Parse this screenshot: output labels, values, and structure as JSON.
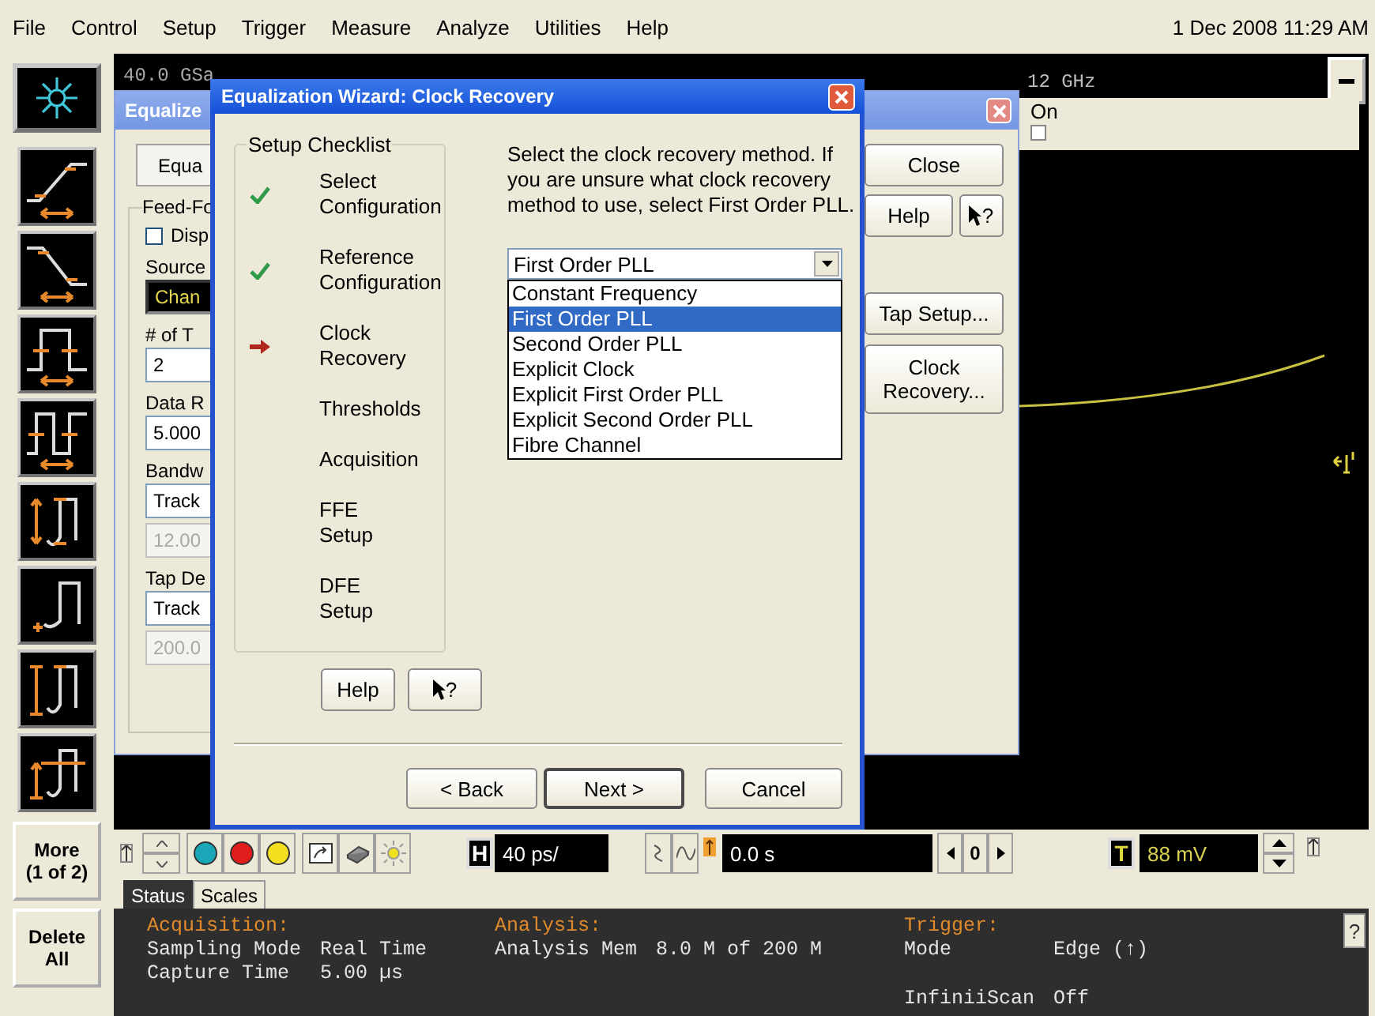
{
  "menu_bar": {
    "items": [
      "File",
      "Control",
      "Setup",
      "Trigger",
      "Measure",
      "Analyze",
      "Utilities",
      "Help"
    ],
    "datetime": "1 Dec 2008 11:29 AM"
  },
  "toolbar": {
    "buttons": [
      "More\n(1 of 2)",
      "Delete\nAll"
    ]
  },
  "scope": {
    "sample_rate": "40.0 GSa",
    "bandwidth": "12 GHz"
  },
  "equalize_window": {
    "title": "Equalize",
    "tab": "Equa",
    "group": "Feed-Fo",
    "display_checkbox": {
      "label": "Disp",
      "checked": false
    },
    "fields": [
      {
        "label": "Source",
        "value": "Chan",
        "kind": "channel"
      },
      {
        "label": "# of T",
        "value": "2",
        "kind": "input"
      },
      {
        "label": "Data R",
        "value": "5.000",
        "kind": "input"
      },
      {
        "label": "Bandw",
        "value": "Track",
        "kind": "input"
      },
      {
        "value": "12.00",
        "kind": "disabled"
      },
      {
        "label": "Tap De",
        "value": "Track",
        "kind": "input"
      },
      {
        "value": "200.0",
        "kind": "disabled"
      }
    ],
    "close_button": "Close",
    "help_button": "Help",
    "help_cursor": "?",
    "tap_setup_button": "Tap Setup...",
    "clock_recovery_button": "Clock\nRecovery..."
  },
  "on_panel": {
    "label": "On",
    "checked": false
  },
  "dialog": {
    "title": "Equalization Wizard: Clock Recovery",
    "checklist": {
      "title": "Setup Checklist",
      "items": [
        {
          "label": "Select\nConfiguration",
          "checked": true,
          "current": false
        },
        {
          "label": "Reference\nConfiguration",
          "checked": true,
          "current": false
        },
        {
          "label": "Clock\nRecovery",
          "checked": false,
          "current": true
        },
        {
          "label": "Thresholds",
          "checked": false,
          "current": false
        },
        {
          "label": "Acquisition",
          "checked": false,
          "current": false
        },
        {
          "label": "FFE\nSetup",
          "checked": false,
          "current": false
        },
        {
          "label": "DFE\nSetup",
          "checked": false,
          "current": false
        }
      ]
    },
    "instructions": "Select the clock recovery method. If\nyou are unsure what clock recovery\nmethod to use, select First Order PLL.",
    "method": {
      "value": "First Order PLL",
      "expanded": true,
      "options": [
        {
          "label": "Constant Frequency",
          "selected": false
        },
        {
          "label": "First Order PLL",
          "selected": true
        },
        {
          "label": "Second Order PLL",
          "selected": false
        },
        {
          "label": "Explicit Clock",
          "selected": false
        },
        {
          "label": "Explicit First Order PLL",
          "selected": false
        },
        {
          "label": "Explicit Second Order PLL",
          "selected": false
        },
        {
          "label": "Fibre Channel",
          "selected": false
        }
      ]
    },
    "help_button": "Help",
    "help_cursor": "?",
    "buttons": [
      {
        "label": "< Back",
        "default": false
      },
      {
        "label": "Next >",
        "default": true
      },
      {
        "label": "Cancel",
        "default": false
      }
    ]
  },
  "controls": {
    "h_label": "H",
    "horizontal_scale": "40 ps/",
    "position": "0.0 s",
    "navigation": "0",
    "t_label": "T",
    "trigger_level": "88 mV"
  },
  "tabs": [
    {
      "label": "Status",
      "selected": true
    },
    {
      "label": "Scales",
      "selected": false
    }
  ],
  "status": {
    "help": "?",
    "sections": [
      {
        "title": "Acquisition:",
        "rows": [
          {
            "label": "Sampling Mode",
            "value": "Real Time"
          },
          {
            "label": "Capture Time",
            "value": "5.00 µs"
          }
        ]
      },
      {
        "title": "Analysis:",
        "rows": [
          {
            "label": "Analysis Mem",
            "value": "8.0 M of 200 M"
          }
        ]
      },
      {
        "title": "Trigger:",
        "rows": [
          {
            "label": "Mode",
            "value": "Edge (↑)"
          },
          {
            "label": "InfiniiScan",
            "value": "Off"
          }
        ]
      }
    ]
  }
}
